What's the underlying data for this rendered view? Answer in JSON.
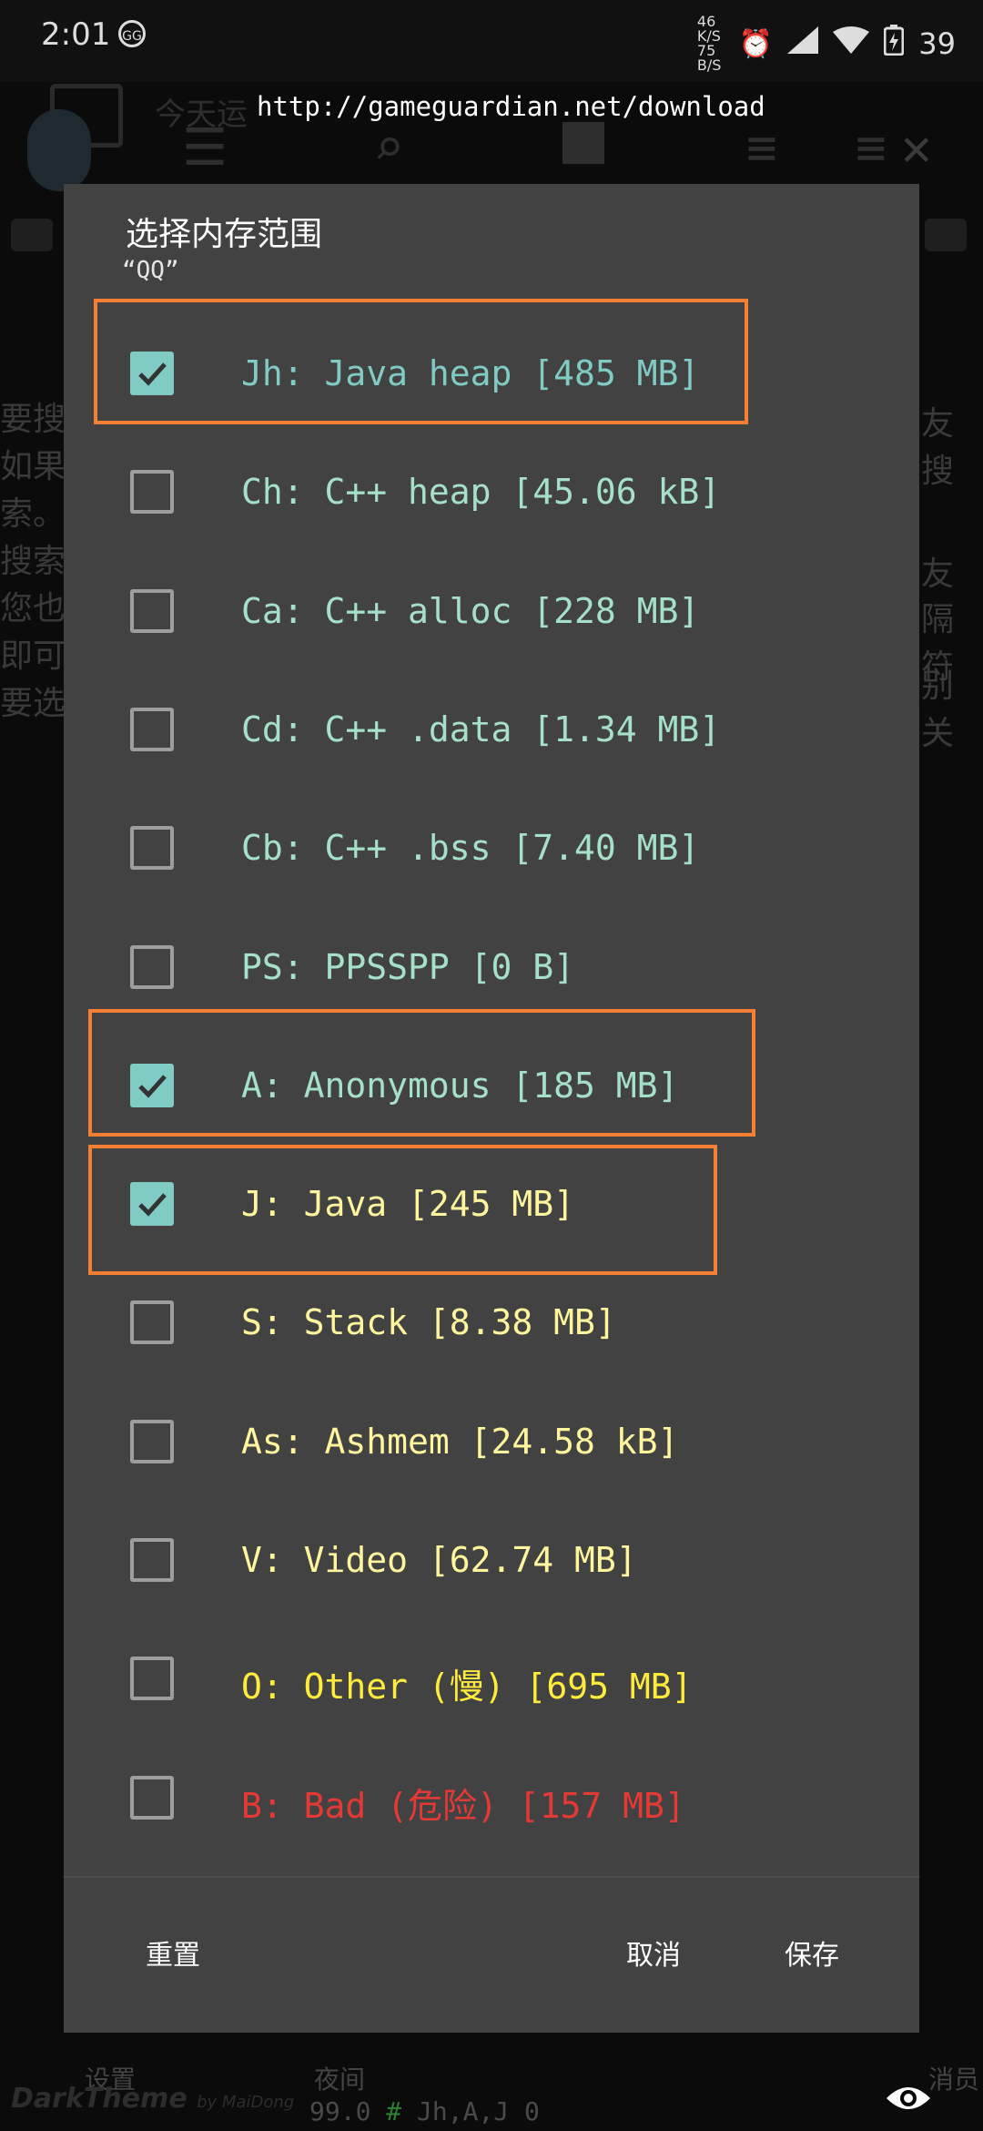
{
  "status_bar": {
    "time": "2:01",
    "gg_badge": "GG",
    "net_speed_top": "46 K/S",
    "net_speed_bottom": "75 B/S",
    "battery": "39"
  },
  "background": {
    "url": "http://gameguardian.net/download",
    "today_text": "今天运",
    "text_lines": [
      "要搜",
      "如果",
      "索。",
      "搜索",
      "您也",
      "即可",
      "要选"
    ],
    "right_fragments": [
      "友",
      "搜",
      "友",
      "隔符",
      "别关"
    ],
    "bottom_settings": "设置",
    "bottom_night": "夜间",
    "bottom_close": "消员",
    "theme": "DarkTheme",
    "theme_by": "by MaiDong",
    "status_line_value": "99.0",
    "status_line_hash": "#",
    "status_line_ranges": "Jh,A,J 0"
  },
  "dialog": {
    "title": "选择内存范围",
    "subtitle": "“QQ”",
    "items": [
      {
        "label": "Jh: Java heap [485 MB]",
        "checked": true,
        "color": "#80cbc4"
      },
      {
        "label": "Ch: C++ heap [45.06 kB]",
        "checked": false,
        "color": "#a5e0c8"
      },
      {
        "label": "Ca: C++ alloc [228 MB]",
        "checked": false,
        "color": "#a5e0c8"
      },
      {
        "label": "Cd: C++ .data [1.34 MB]",
        "checked": false,
        "color": "#a5e0c8"
      },
      {
        "label": "Cb: C++ .bss [7.40 MB]",
        "checked": false,
        "color": "#a5e0c8"
      },
      {
        "label": "PS: PPSSPP [0 B]",
        "checked": false,
        "color": "#a5e0c8"
      },
      {
        "label": "A: Anonymous [185 MB]",
        "checked": true,
        "color": "#a5e0c8"
      },
      {
        "label": "J: Java [245 MB]",
        "checked": true,
        "color": "#fff59d"
      },
      {
        "label": "S: Stack [8.38 MB]",
        "checked": false,
        "color": "#fff59d"
      },
      {
        "label": "As: Ashmem [24.58 kB]",
        "checked": false,
        "color": "#fff59d"
      },
      {
        "label": "V: Video [62.74 MB]",
        "checked": false,
        "color": "#fff59d"
      },
      {
        "label": "O: Other (慢) [695 MB]",
        "checked": false,
        "color": "#ffeb3b"
      },
      {
        "label": "B: Bad (危险) [157 MB]",
        "checked": false,
        "color": "#e53935"
      }
    ],
    "reset_label": "重置",
    "cancel_label": "取消",
    "save_label": "保存"
  },
  "colors": {
    "highlight": "#f57f33",
    "dialog_bg": "#424242",
    "checkbox_checked": "#80cbc4"
  }
}
